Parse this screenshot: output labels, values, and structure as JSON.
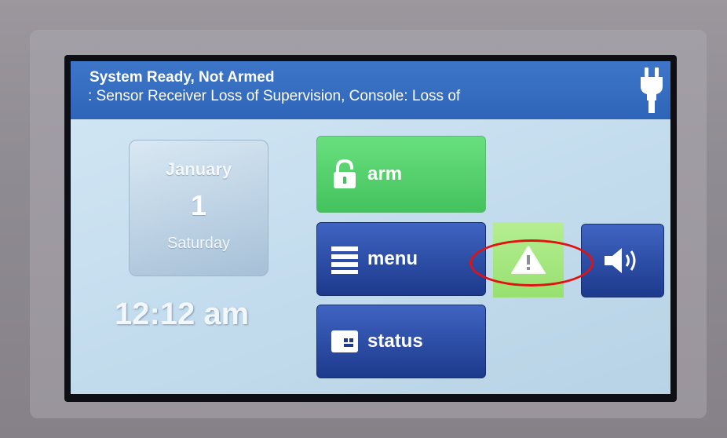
{
  "status_bar": {
    "title": "System Ready, Not Armed",
    "detail": ": Sensor Receiver Loss of Supervision, Console: Loss of"
  },
  "date_card": {
    "month": "January",
    "day": "1",
    "weekday": "Saturday"
  },
  "clock": {
    "time": "12:12 am"
  },
  "buttons": {
    "arm": {
      "label": "arm",
      "icon": "padlock-icon"
    },
    "menu": {
      "label": "menu",
      "icon": "list-icon"
    },
    "status": {
      "label": "status",
      "icon": "panel-icon"
    },
    "alert": {
      "icon": "warning-triangle-icon"
    },
    "volume": {
      "icon": "speaker-volume-icon"
    }
  },
  "colors": {
    "status_bar": "#2f65b8",
    "arm_button": "#44c25d",
    "blue_button": "#1d3a8c",
    "alert_button": "#98e070",
    "annotation": "#e01212"
  }
}
